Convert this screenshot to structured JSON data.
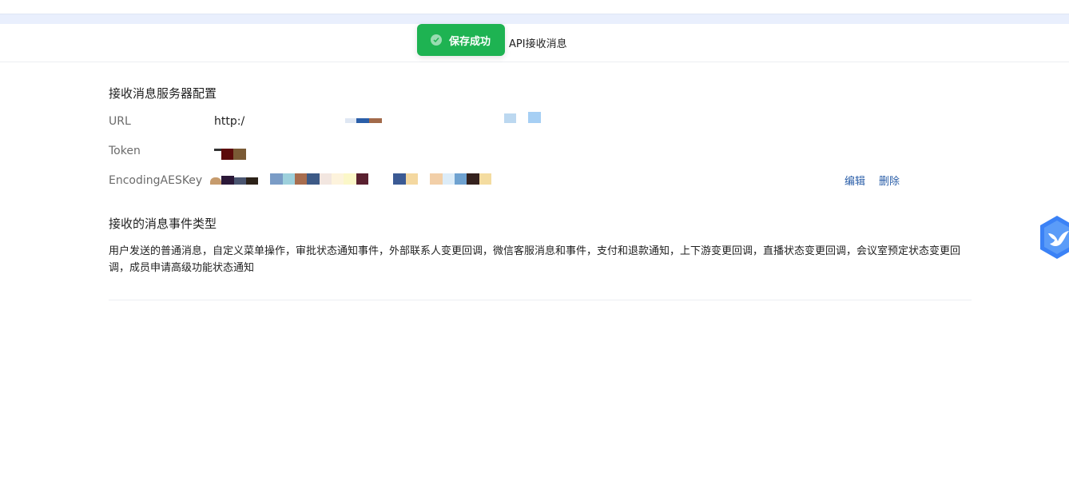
{
  "header": {
    "title": "API接收消息"
  },
  "toast": {
    "message": "保存成功",
    "color": "#1eb352"
  },
  "server_config": {
    "section_title": "接收消息服务器配置",
    "url": {
      "label": "URL",
      "value": "http:/"
    },
    "token": {
      "label": "Token",
      "value": ""
    },
    "aes_key": {
      "label": "EncodingAESKey",
      "value": ""
    },
    "actions": {
      "edit_label": "编辑",
      "delete_label": "删除"
    }
  },
  "event_types": {
    "section_title": "接收的消息事件类型",
    "description": "用户发送的普通消息，自定义菜单操作，审批状态通知事件，外部联系人变更回调，微信客服消息和事件，支付和退款通知，上下游变更回调，直播状态变更回调，会议室预定状态变更回调，成员申请高级功能状态通知"
  },
  "colors": {
    "link": "#2a5ea8",
    "label": "#6b6b6b",
    "header_band": "#e9effd"
  },
  "icons": {
    "toast_icon": "check-circle-icon",
    "floating_assistant": "bird-shield-icon"
  }
}
